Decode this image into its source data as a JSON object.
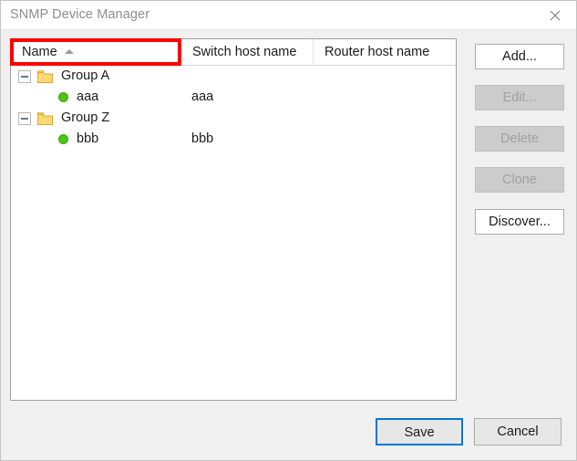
{
  "window": {
    "title": "SNMP Device Manager",
    "close_icon": "close-icon"
  },
  "list": {
    "columns": [
      {
        "label": "Name",
        "sorted": "ascending"
      },
      {
        "label": "Switch host name",
        "sorted": ""
      },
      {
        "label": "Router host name",
        "sorted": ""
      }
    ],
    "rows": [
      {
        "type": "group",
        "expander": "collapse-minus-icon",
        "icon": "folder-icon",
        "name": "Group A",
        "switch_host": "",
        "router_host": ""
      },
      {
        "type": "device",
        "icon": "status-dot-green-icon",
        "name": "aaa",
        "switch_host": "aaa",
        "router_host": ""
      },
      {
        "type": "group",
        "expander": "collapse-minus-icon",
        "icon": "folder-icon",
        "name": "Group Z",
        "switch_host": "",
        "router_host": ""
      },
      {
        "type": "device",
        "icon": "status-dot-green-icon",
        "name": "bbb",
        "switch_host": "bbb",
        "router_host": ""
      }
    ]
  },
  "side_buttons": [
    {
      "label": "Add...",
      "enabled": true
    },
    {
      "label": "Edit...",
      "enabled": false
    },
    {
      "label": "Delete",
      "enabled": false
    },
    {
      "label": "Clone",
      "enabled": false
    },
    {
      "label": "Discover...",
      "enabled": true
    }
  ],
  "bottom_buttons": {
    "save": "Save",
    "cancel": "Cancel"
  },
  "colors": {
    "focus_border": "#0078d7",
    "highlight_rect": "#ff0000",
    "status_green": "#4ec216",
    "folder_yellow": "#fcd975",
    "title_text": "#8d8d8d"
  }
}
